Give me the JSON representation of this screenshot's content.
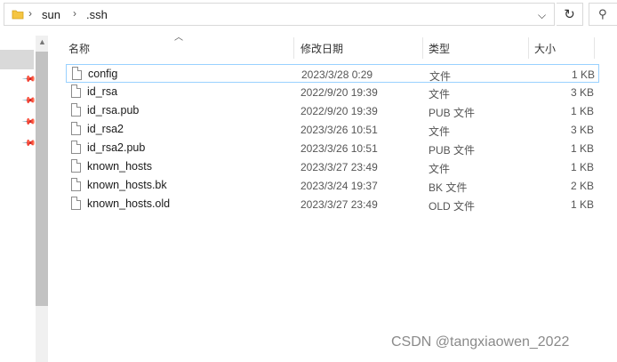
{
  "breadcrumb": {
    "items": [
      "sun",
      ".ssh"
    ],
    "separator": "›"
  },
  "toolbar": {
    "refresh_glyph": "↻",
    "dropdown_glyph": "⌵",
    "search_glyph": "⚲"
  },
  "columns": {
    "name": "名称",
    "date": "修改日期",
    "type": "类型",
    "size": "大小"
  },
  "files": [
    {
      "name": "config",
      "date": "2023/3/28 0:29",
      "type": "文件",
      "size": "1 KB",
      "selected": true
    },
    {
      "name": "id_rsa",
      "date": "2022/9/20 19:39",
      "type": "文件",
      "size": "3 KB"
    },
    {
      "name": "id_rsa.pub",
      "date": "2022/9/20 19:39",
      "type": "PUB 文件",
      "size": "1 KB"
    },
    {
      "name": "id_rsa2",
      "date": "2023/3/26 10:51",
      "type": "文件",
      "size": "3 KB"
    },
    {
      "name": "id_rsa2.pub",
      "date": "2023/3/26 10:51",
      "type": "PUB 文件",
      "size": "1 KB"
    },
    {
      "name": "known_hosts",
      "date": "2023/3/27 23:49",
      "type": "文件",
      "size": "1 KB"
    },
    {
      "name": "known_hosts.bk",
      "date": "2023/3/24 19:37",
      "type": "BK 文件",
      "size": "2 KB"
    },
    {
      "name": "known_hosts.old",
      "date": "2023/3/27 23:49",
      "type": "OLD 文件",
      "size": "1 KB"
    }
  ],
  "watermark": "CSDN @tangxiaowen_2022",
  "colors": {
    "folder": "#f5c542",
    "selection_border": "#99d1ff",
    "nav_selected": "#d9d9d9"
  }
}
